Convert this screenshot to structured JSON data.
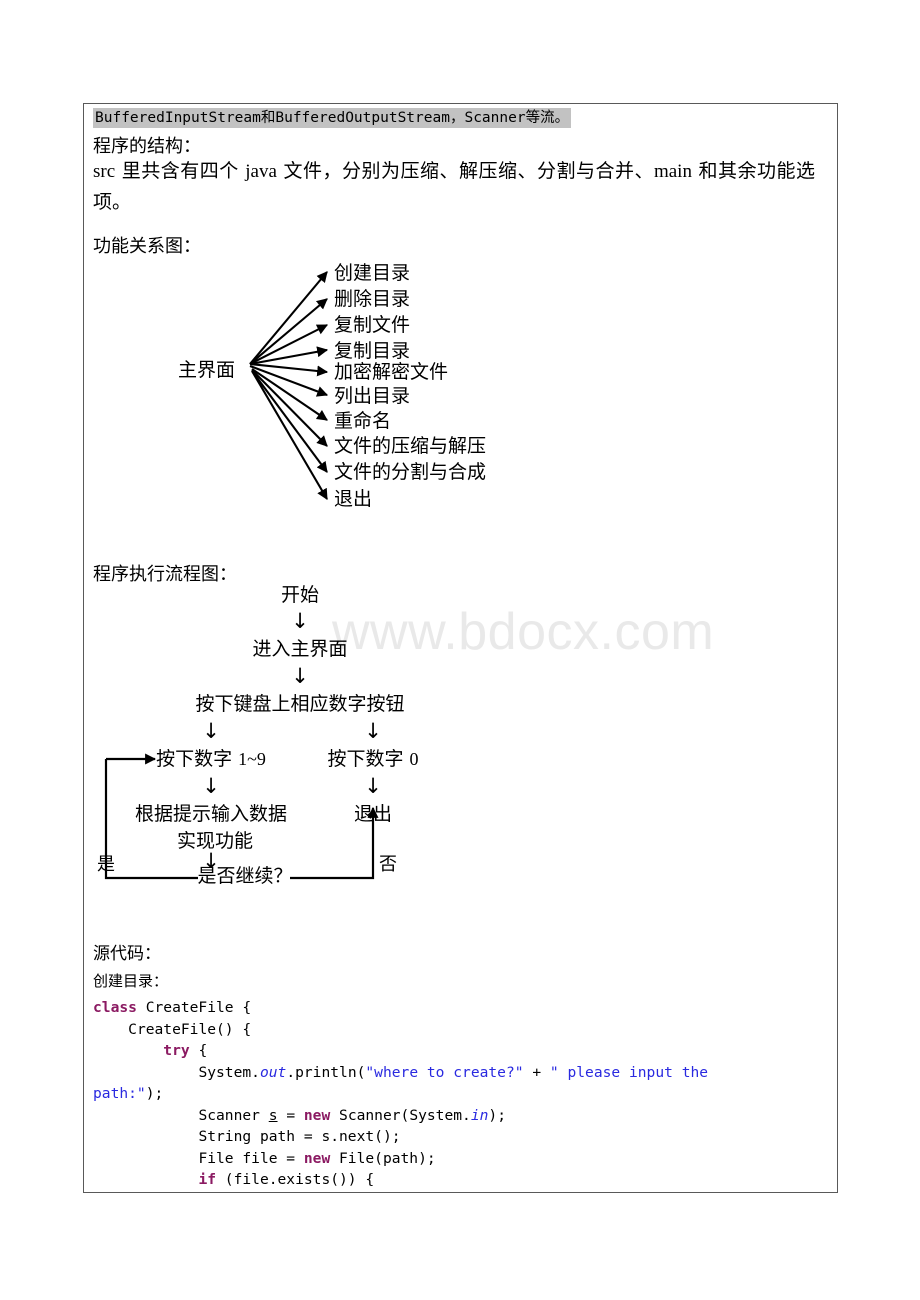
{
  "document": {
    "watermark": "www.bdocx.com",
    "highlighted_line": "BufferedInputStream和BufferedOutputStream，Scanner等流。",
    "section_structure_title": "程序的结构：",
    "structure_paragraph_parts": {
      "p1": "src",
      "p2": " 里共含有四个 ",
      "p3": "java",
      "p4": " 文件，分别为压缩、解压缩、分割与合并、",
      "p5": "main",
      "p6": " 和其余功能选项。"
    },
    "section_fan_title": "功能关系图：",
    "section_flow_title": "程序执行流程图：",
    "section_source_title": "源代码：",
    "section_source_subtitle": "创建目录："
  },
  "fan_diagram": {
    "root": "主界面",
    "items": [
      "创建目录",
      "删除目录",
      "复制文件",
      "复制目录",
      "加密解密文件",
      "列出目录",
      "重命名",
      "文件的压缩与解压",
      "文件的分割与合成",
      "退出"
    ]
  },
  "flow_chart": {
    "nodes": {
      "start": "开始",
      "enter_main": "进入主界面",
      "press_key": "按下键盘上相应数字按钮",
      "press_1_9_pre": "按下数字 ",
      "press_1_9_num": "1~9",
      "press_0_pre": "按下数字 ",
      "press_0_num": "0",
      "input_data": "根据提示输入数据",
      "realize_function": "实现功能",
      "exit": "退出",
      "continue_q": "是否继续？"
    },
    "labels": {
      "yes": "是",
      "no": "否"
    },
    "arrow_glyph": "↓"
  },
  "source_code": {
    "lines": [
      {
        "parts": [
          {
            "t": "class ",
            "c": "k"
          },
          {
            "t": "CreateFile {",
            "c": ""
          }
        ]
      },
      {
        "parts": [
          {
            "t": "    CreateFile() {",
            "c": ""
          }
        ]
      },
      {
        "parts": [
          {
            "t": "        ",
            "c": ""
          },
          {
            "t": "try",
            "c": "k"
          },
          {
            "t": " {",
            "c": ""
          }
        ]
      },
      {
        "parts": [
          {
            "t": "            System.",
            "c": ""
          },
          {
            "t": "out",
            "c": "f"
          },
          {
            "t": ".println(",
            "c": ""
          },
          {
            "t": "\"where to create?\"",
            "c": "s"
          },
          {
            "t": " + ",
            "c": ""
          },
          {
            "t": "\" please input the",
            "c": "s"
          }
        ]
      },
      {
        "parts": [
          {
            "t": "path:\"",
            "c": "s"
          },
          {
            "t": ");",
            "c": ""
          }
        ]
      },
      {
        "parts": [
          {
            "t": "            Scanner ",
            "c": ""
          },
          {
            "t": "s",
            "c": "u"
          },
          {
            "t": " = ",
            "c": ""
          },
          {
            "t": "new",
            "c": "k"
          },
          {
            "t": " Scanner(System.",
            "c": ""
          },
          {
            "t": "in",
            "c": "f"
          },
          {
            "t": ");",
            "c": ""
          }
        ]
      },
      {
        "parts": [
          {
            "t": "            String path = s.next();",
            "c": ""
          }
        ]
      },
      {
        "parts": [
          {
            "t": "            File file = ",
            "c": ""
          },
          {
            "t": "new",
            "c": "k"
          },
          {
            "t": " File(path);",
            "c": ""
          }
        ]
      },
      {
        "parts": [
          {
            "t": "            ",
            "c": ""
          },
          {
            "t": "if",
            "c": "k"
          },
          {
            "t": " (file.exists()) {",
            "c": ""
          }
        ]
      }
    ]
  },
  "colors": {
    "keyword": "#8b1a62",
    "string": "#2a2ae0",
    "field": "#2a2ae0",
    "highlight_bg": "#c2c2c2",
    "border": "#595959",
    "watermark": "#e9e9e9"
  }
}
